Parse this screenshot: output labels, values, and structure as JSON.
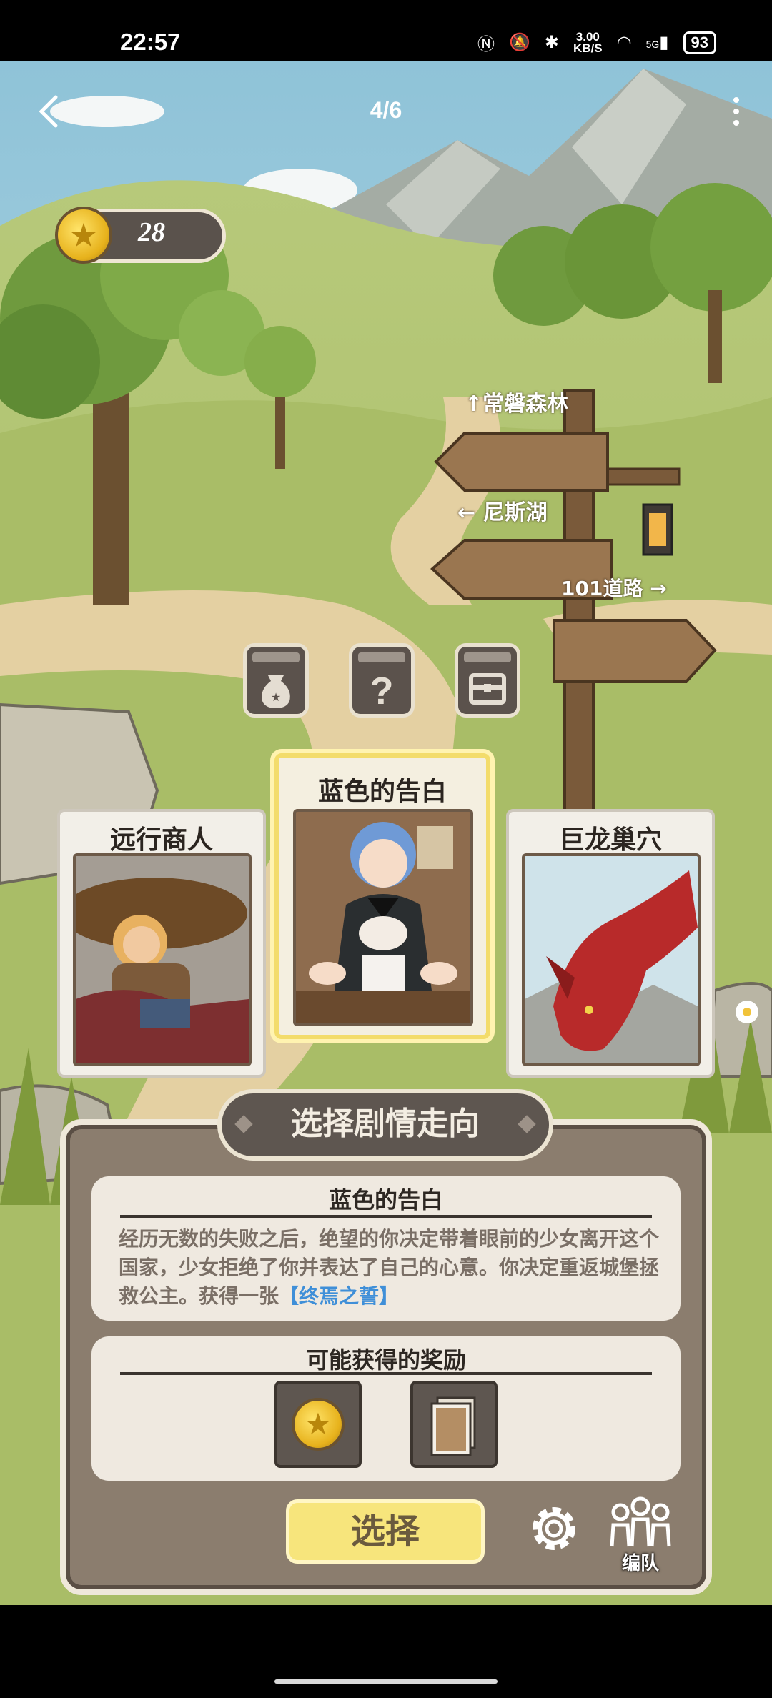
{
  "status_bar": {
    "time": "22:57",
    "network_speed": "3.00",
    "network_speed_unit": "KB/S",
    "signal_label": "5G",
    "battery": "93"
  },
  "nav": {
    "page_indicator": "4/6"
  },
  "coins": {
    "count": "28"
  },
  "signposts": [
    {
      "label": "常磐森林",
      "arrow": "↑"
    },
    {
      "label": "尼斯湖",
      "arrow": "←"
    },
    {
      "label": "101道路",
      "arrow": "→"
    }
  ],
  "dice": [
    {
      "icon": "money-bag-icon"
    },
    {
      "icon": "question-mark-icon"
    },
    {
      "icon": "treasure-chest-icon"
    }
  ],
  "cards": {
    "left": {
      "title": "远行商人"
    },
    "center": {
      "title": "蓝色的告白"
    },
    "right": {
      "title": "巨龙巢穴"
    }
  },
  "panel": {
    "header": "选择剧情走向",
    "story_title": "蓝色的告白",
    "story_text": "经历无数的失败之后，绝望的你决定带着眼前的少女离开这个国家，少女拒绝了你并表达了自己的心意。你决定重返城堡拯救公主。获得一张",
    "story_highlight": "【终焉之誓】",
    "rewards_title": "可能获得的奖励",
    "rewards": [
      {
        "icon": "coin-icon"
      },
      {
        "icon": "card-icon"
      }
    ],
    "select_label": "选择",
    "team_label": "编队"
  },
  "colors": {
    "panel_bg": "#8b7d6e",
    "panel_light": "#efe9e0",
    "select_button": "#f7e57c",
    "highlight_text": "#3f8fd8",
    "selected_card_glow": "#f3dc6b"
  }
}
